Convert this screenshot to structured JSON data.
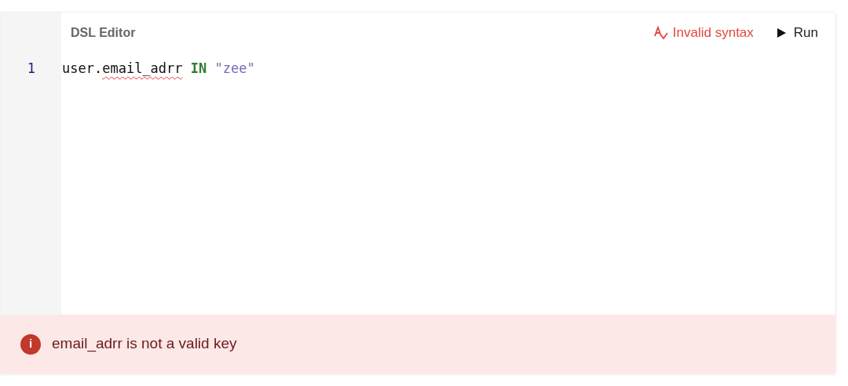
{
  "editor": {
    "title": "DSL Editor",
    "status": {
      "text": "Invalid syntax",
      "kind": "invalid"
    },
    "run_button": {
      "label": "Run"
    },
    "lines": [
      {
        "number": "1",
        "tokens": [
          {
            "text": "user.",
            "kind": "plain",
            "error": false,
            "space_before": false
          },
          {
            "text": "email_adrr",
            "kind": "plain",
            "error": true,
            "space_before": false
          },
          {
            "text": "IN",
            "kind": "keyword",
            "error": false,
            "space_before": true
          },
          {
            "text": "\"zee\"",
            "kind": "string",
            "error": false,
            "space_before": true
          }
        ]
      }
    ]
  },
  "error_banner": {
    "message": "email_adrr is not a valid key",
    "icon_text": "i"
  }
}
